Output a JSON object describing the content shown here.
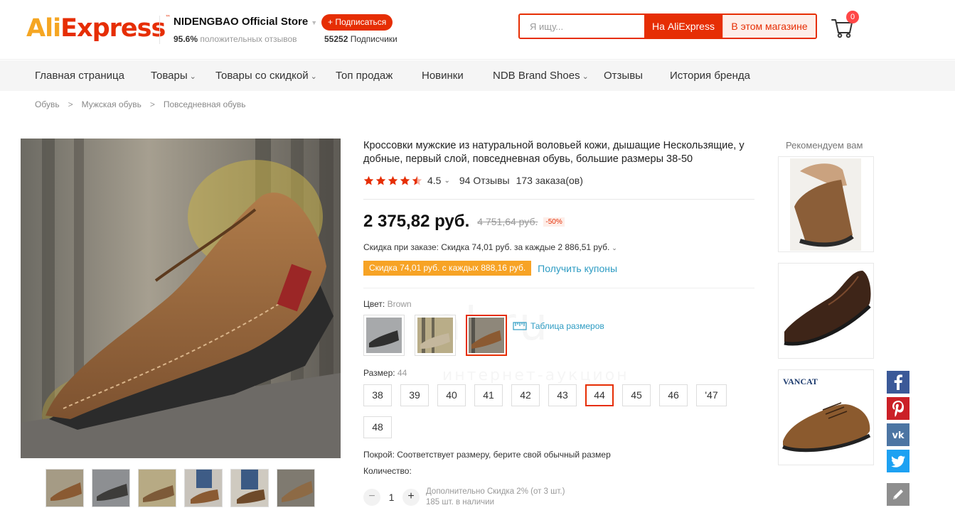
{
  "header": {
    "logo_text_a": "Ali",
    "logo_text_b": "Express",
    "logo_tm": "™",
    "store_name": "NIDENGBAO Official Store",
    "store_caret": "▼",
    "positive_pct": "95.6%",
    "positive_text": "положительных отзывов",
    "subscribe_label": "+ Подписаться",
    "followers_count": "55252",
    "followers_text": "Подписчики",
    "search_placeholder": "Я ищу...",
    "search_btn_all": "На AliExpress",
    "search_btn_store": "В этом магазине",
    "cart_icon": "cart-icon",
    "cart_count": "0"
  },
  "nav": {
    "items": [
      {
        "label": "Главная страница",
        "chevron": ""
      },
      {
        "label": "Товары",
        "chevron": "⌄"
      },
      {
        "label": "Товары со скидкой",
        "chevron": "⌄"
      },
      {
        "label": "Топ продаж",
        "chevron": ""
      },
      {
        "label": "Новинки",
        "chevron": ""
      },
      {
        "label": "NDB Brand Shoes",
        "chevron": "⌄"
      },
      {
        "label": "Отзывы",
        "chevron": ""
      },
      {
        "label": "История бренда",
        "chevron": ""
      }
    ]
  },
  "breadcrumb": {
    "items": [
      "Обувь",
      "Мужская обувь",
      "Повседневная обувь"
    ],
    "separator": ">"
  },
  "product": {
    "title": "Кроссовки мужские из натуральной воловьей кожи, дышащие Нескользящие, у добные, первый слой, повседневная обувь, большие размеры 38-50",
    "rating_value": 4.5,
    "rating_text": "4.5",
    "rating_caret": "⌄",
    "reviews": "94 Отзывы",
    "orders": "173 заказа(ов)",
    "price": "2 375,82 руб.",
    "old_price": "4 751,64 руб.",
    "discount": "-50%",
    "order_discount": "Скидка при заказе: Скидка 74,01 руб. за каждые 2 886,51 руб.",
    "order_discount_caret": "⌄",
    "coupon_tag": "Скидка 74,01 руб. с каждых 888,16 руб.",
    "coupon_link": "Получить купоны",
    "color_label": "Цвет:",
    "color_value": "Brown",
    "color_swatches": [
      "black",
      "beige",
      "brown"
    ],
    "color_selected_index": 2,
    "size_chart_label": "Таблица размеров",
    "size_label": "Размер:",
    "size_value": "44",
    "sizes": [
      "38",
      "39",
      "40",
      "41",
      "42",
      "43",
      "44",
      "45",
      "46",
      "'47",
      "48"
    ],
    "size_selected": "44",
    "fit": "Покрой: Соответствует размеру, берите свой обычный размер",
    "qty_label": "Количество:",
    "qty_minus": "−",
    "qty_plus": "+",
    "qty_value": "1",
    "qty_promo": "Дополнительно Скидка 2% (от 3 шт.)",
    "qty_stock": "185 шт. в наличии",
    "thumbnail_count": 6
  },
  "recommend": {
    "title": "Рекомендуем вам",
    "items": [
      {
        "brand": ""
      },
      {
        "brand": ""
      },
      {
        "brand": "VANCAT"
      }
    ]
  },
  "social": [
    "facebook-icon",
    "pinterest-icon",
    "vk-icon",
    "twitter-icon",
    "edit-icon"
  ],
  "watermark": {
    "line1": "al.ru",
    "line2": "интернет-аукцион"
  },
  "colors": {
    "accent": "#e62e04",
    "coupon": "#f7a325",
    "link": "#2e9cc3",
    "star": "#e62e04",
    "facebook": "#3b5998",
    "pinterest": "#cb2027",
    "vk": "#4c75a3",
    "twitter": "#1da1f2",
    "edit": "#8e8e8e"
  }
}
